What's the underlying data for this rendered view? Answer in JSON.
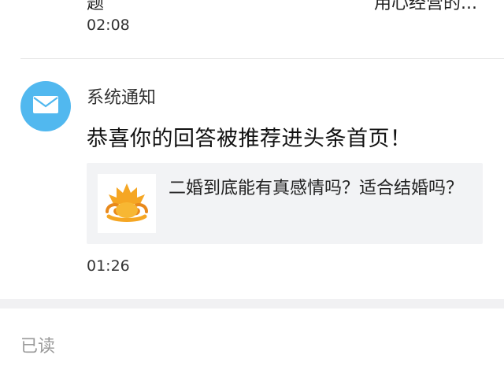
{
  "previous_item": {
    "snippet_left": "题",
    "snippet_right": "用心经营的...",
    "time": "02:08"
  },
  "notification": {
    "avatar_icon": "mail-icon",
    "sender": "系统通知",
    "headline": "恭喜你的回答被推荐进头条首页！",
    "card": {
      "thumbnail_icon": "auspicious-cloud-logo-icon",
      "title": "二婚到底能有真感情吗？适合结婚吗？"
    },
    "time": "01:26"
  },
  "section": {
    "read_label": "已读"
  },
  "colors": {
    "avatar_bg": "#51b8ef",
    "card_bg": "#f2f3f5",
    "logo_orange": "#f5a623"
  }
}
